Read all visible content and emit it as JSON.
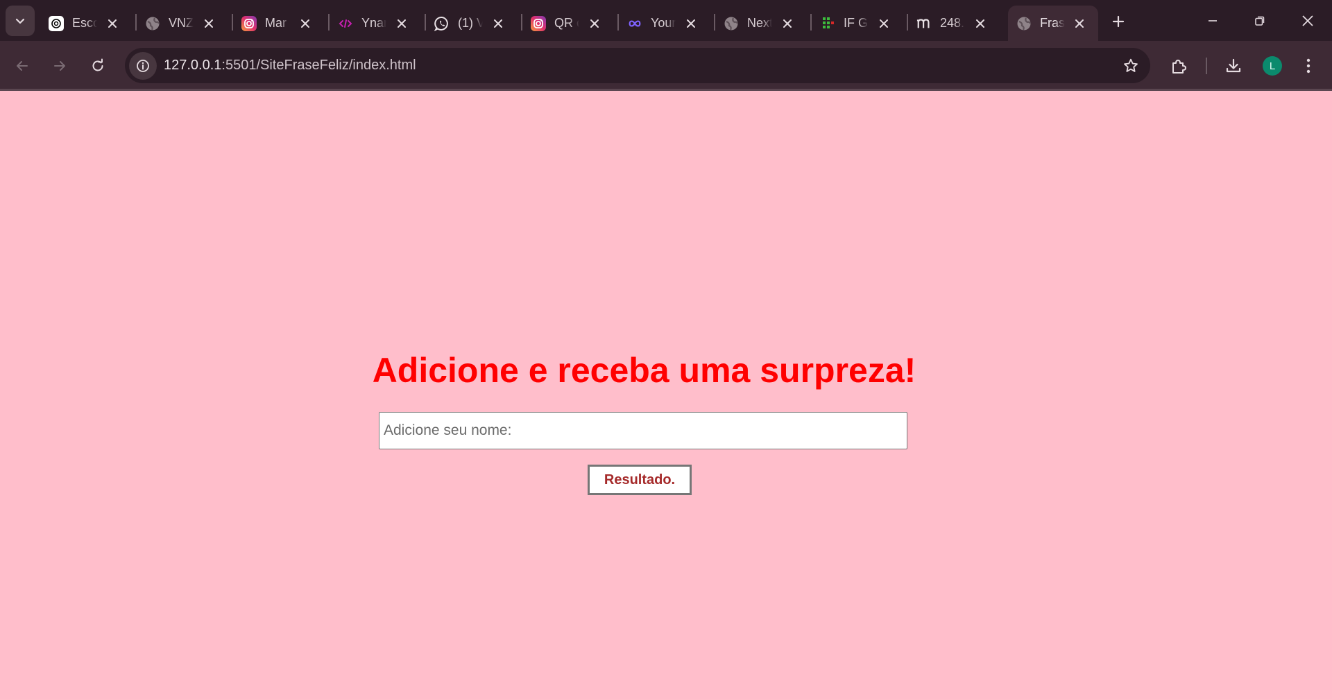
{
  "browser": {
    "tabs": [
      {
        "title": "Esco",
        "icon": "chatgpt-icon",
        "active": false
      },
      {
        "title": "VNZ",
        "icon": "globe-icon",
        "active": false
      },
      {
        "title": "Mar",
        "icon": "instagram-icon",
        "active": false
      },
      {
        "title": "Ynar",
        "icon": "code-icon",
        "active": false
      },
      {
        "title": "(1) V",
        "icon": "whatsapp-icon",
        "active": false
      },
      {
        "title": "QR c",
        "icon": "instagram-icon",
        "active": false
      },
      {
        "title": "Your",
        "icon": "meta-infinity-icon",
        "active": false
      },
      {
        "title": "Next",
        "icon": "globe-icon",
        "active": false
      },
      {
        "title": "IF G",
        "icon": "grid-dots-icon",
        "active": false
      },
      {
        "title": "248.",
        "icon": "m-logo-icon",
        "active": false
      },
      {
        "title": "Fras",
        "icon": "globe-icon",
        "active": true
      }
    ],
    "url_host": "127.0.0.1",
    "url_path": ":5501/SiteFraseFeliz/index.html",
    "profile_initial": "L",
    "colors": {
      "frame": "#2b1c26",
      "toolbar": "#3e2a35",
      "avatar": "#0b8a6d"
    }
  },
  "page": {
    "heading": "Adicione e receba uma surpreza!",
    "name_placeholder": "Adicione seu nome:",
    "name_value": "",
    "result_button": "Resultado.",
    "colors": {
      "background": "#ffbecb",
      "heading": "#ff0000",
      "button_text": "#a52a2a"
    }
  }
}
